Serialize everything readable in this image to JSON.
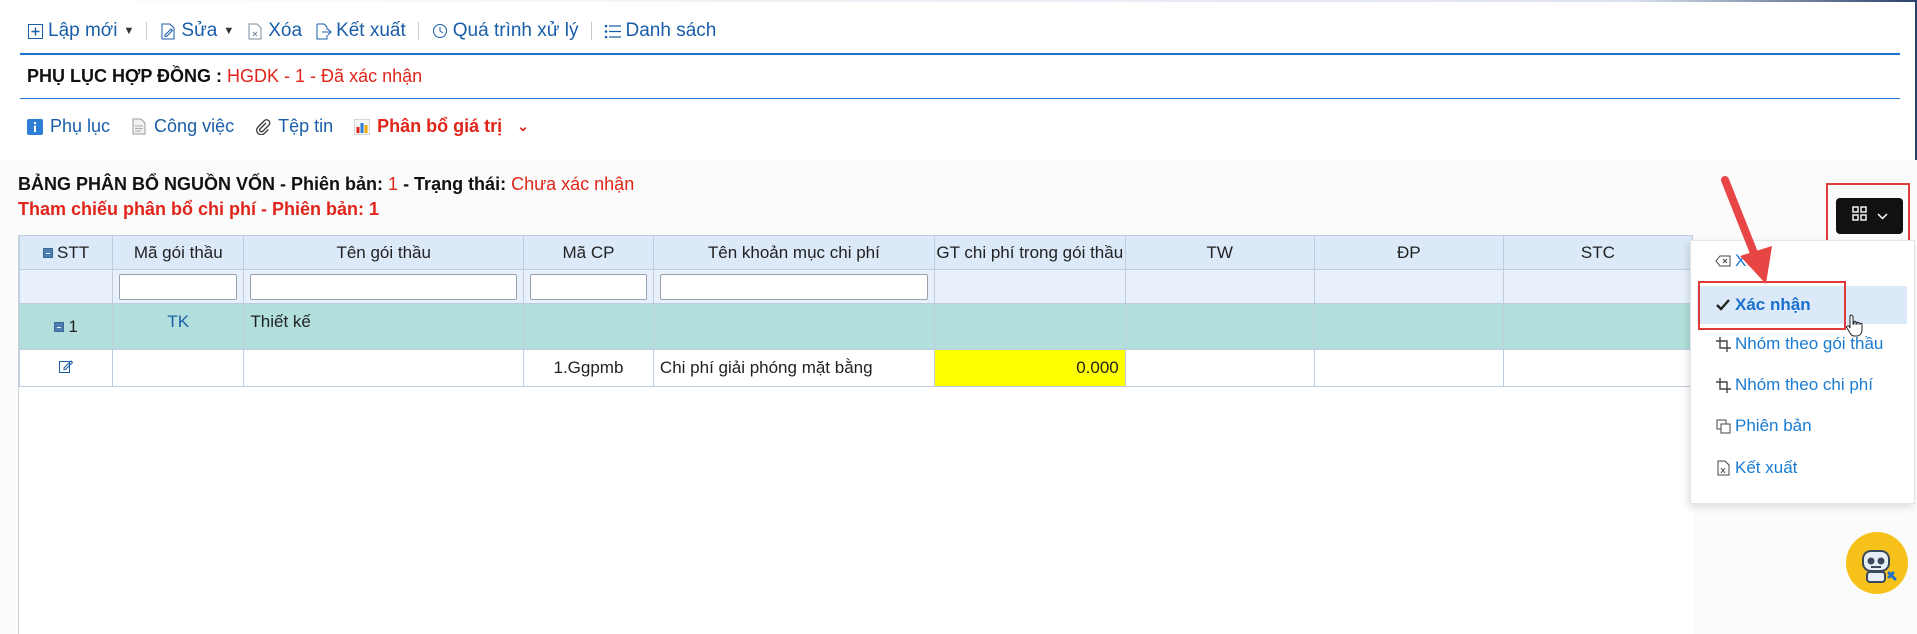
{
  "toolbar": {
    "new": "Lập mới",
    "edit": "Sửa",
    "delete": "Xóa",
    "export": "Kết xuất",
    "process": "Quá trình xử lý",
    "list": "Danh sách"
  },
  "title": {
    "label": "PHỤ LỤC HỢP ĐỒNG :",
    "value": "HGDK - 1 - Đã xác nhận"
  },
  "tabs": {
    "appendix": "Phụ lục",
    "work": "Công việc",
    "files": "Tệp tin",
    "allocation": "Phân bổ giá trị"
  },
  "section": {
    "heading_prefix": "BẢNG PHÂN BỔ NGUỒN VỐN - Phiên bản:",
    "version": "1",
    "status_label": "- Trạng thái:",
    "status_value": "Chưa xác nhận",
    "reference": "Tham chiếu phân bổ chi phí - Phiên bản: 1"
  },
  "table": {
    "columns": [
      "STT",
      "Mã gói thầu",
      "Tên gói thầu",
      "Mã CP",
      "Tên khoản mục chi phí",
      "GT chi phí trong gói thầu",
      "TW",
      "ĐP",
      "STC"
    ],
    "group_row": {
      "stt": "1",
      "code": "TK",
      "name": "Thiết kế"
    },
    "detail_row": {
      "cost_code": "1.Ggpmb",
      "cost_name": "Chi phí giải phóng mặt bằng",
      "value": "0.000"
    }
  },
  "dropdown": {
    "delete": "Xóa",
    "confirm": "Xác nhận",
    "group_package": "Nhóm theo gói thầu",
    "group_cost": "Nhóm theo chi phí",
    "version": "Phiên bản",
    "export": "Kết xuất"
  },
  "colors": {
    "accent_blue": "#1a5ea8",
    "status_red": "#e0251b",
    "group_row": "#b2dfdb",
    "highlight_cell": "#ffff00",
    "annotation_red": "#e03b3b"
  }
}
